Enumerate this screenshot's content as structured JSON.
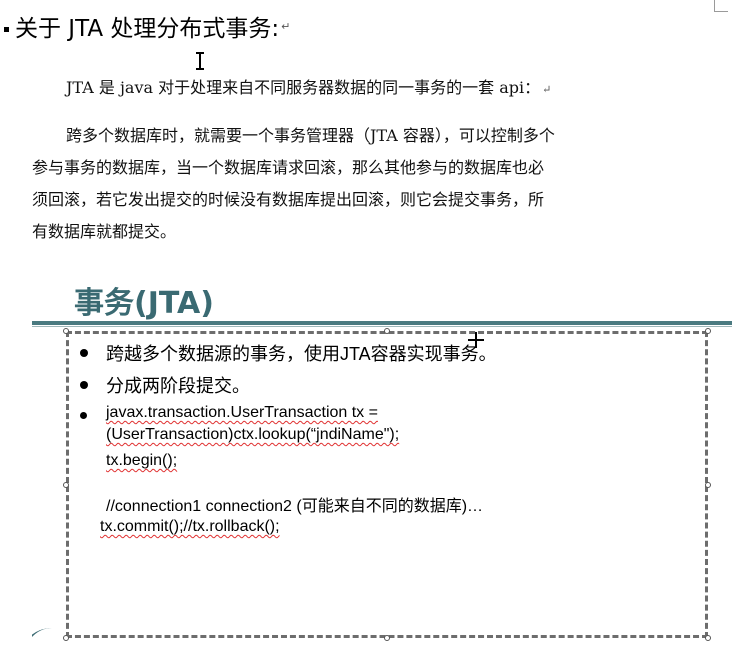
{
  "heading": {
    "text": "关于 JTA 处理分布式事务:",
    "paragraph_mark": "↵"
  },
  "paragraphs": [
    {
      "text": "JTA 是 java 对于处理来自不同服务器数据的同一事务的一套 api：",
      "paragraph_mark": "↵"
    },
    {
      "lines": [
        "跨多个数据库时，就需要一个事务管理器（JTA 容器），可以控制多个",
        "参与事务的数据库，当一个数据库请求回滚，那么其他参与的数据库也必",
        "须回滚，若它发出提交的时候没有数据库提出回滚，则它会提交事务，所",
        "有数据库就都提交。"
      ]
    }
  ],
  "slide": {
    "title": "事务(JTA)",
    "bullets": [
      "跨越多个数据源的事务，使用JTA容器实现事务。",
      "分成两阶段提交。",
      "javax.transaction.UserTransaction tx ="
    ],
    "code_lines": [
      "(UserTransaction)ctx.lookup(“jndiName\");",
      "tx.begin();",
      "//connection1 connection2 (可能来自不同的数据库)…",
      "tx.commit();//tx.rollback();"
    ]
  },
  "colors": {
    "slide_accent": "#3a6a72",
    "spell_underline": "#e03030"
  }
}
